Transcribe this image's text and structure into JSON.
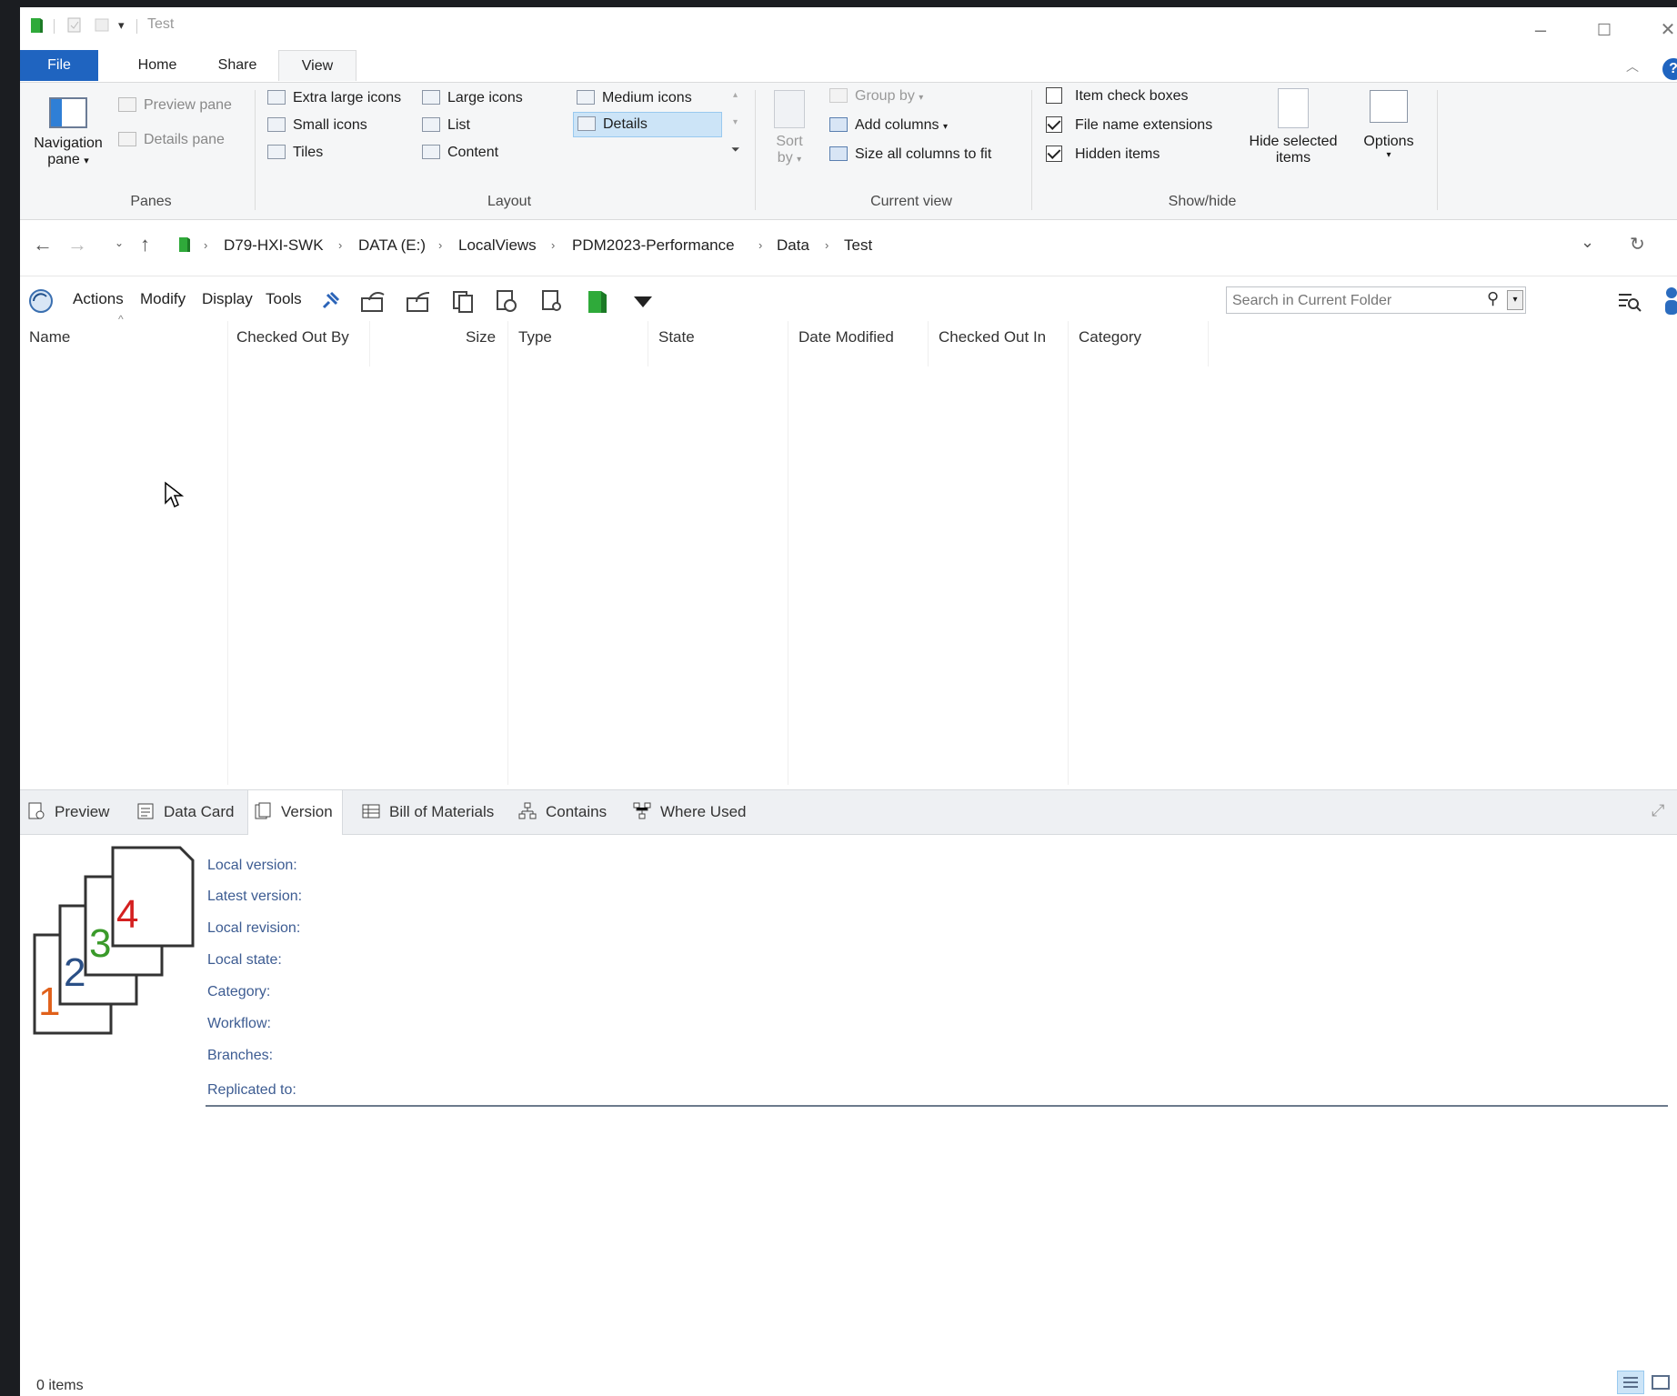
{
  "window": {
    "title": "Test",
    "minimize": "–",
    "maximize": "☐",
    "close": "✕",
    "help": "?"
  },
  "ribbon_tabs": [
    {
      "label": "File"
    },
    {
      "label": "Home"
    },
    {
      "label": "Share"
    },
    {
      "label": "View"
    }
  ],
  "ribbon": {
    "panes": {
      "navigation_pane_line1": "Navigation",
      "navigation_pane_line2": "pane",
      "preview_pane": "Preview pane",
      "details_pane": "Details pane",
      "group_label": "Panes"
    },
    "layout": {
      "extra_large_icons": "Extra large icons",
      "large_icons": "Large icons",
      "medium_icons": "Medium icons",
      "small_icons": "Small icons",
      "list": "List",
      "details": "Details",
      "tiles": "Tiles",
      "content": "Content",
      "group_label": "Layout"
    },
    "current_view": {
      "sort_by_line1": "Sort",
      "sort_by_line2": "by",
      "group_by": "Group by",
      "add_columns": "Add columns",
      "size_all_columns": "Size all columns to fit",
      "group_label": "Current view"
    },
    "show_hide": {
      "item_check_boxes": "Item check boxes",
      "item_check_boxes_checked": false,
      "file_name_extensions": "File name extensions",
      "file_name_extensions_checked": true,
      "hidden_items": "Hidden items",
      "hidden_items_checked": true,
      "hide_selected_line1": "Hide selected",
      "hide_selected_line2": "items",
      "group_label": "Show/hide"
    },
    "options": "Options"
  },
  "address_bar": {
    "crumbs": [
      "D79-HXI-SWK",
      "DATA (E:)",
      "LocalViews",
      "PDM2023-Performance",
      "Data",
      "Test"
    ]
  },
  "pdm_toolbar": {
    "menus": [
      "Actions",
      "Modify",
      "Display",
      "Tools"
    ],
    "search_placeholder": "Search in Current Folder"
  },
  "columns": [
    "Name",
    "Checked Out By",
    "Size",
    "Type",
    "State",
    "Date Modified",
    "Checked Out In",
    "Category"
  ],
  "bottom_tabs": [
    "Preview",
    "Data Card",
    "Version",
    "Bill of Materials",
    "Contains",
    "Where Used"
  ],
  "version_panel": {
    "labels": [
      "Local version:",
      "Latest version:",
      "Local revision:",
      "Local state:",
      "Category:",
      "Workflow:",
      "Branches:",
      "Replicated to:"
    ],
    "icon_numbers": [
      "1",
      "2",
      "3",
      "4"
    ]
  },
  "status": {
    "item_count": "0 items"
  },
  "colors": {
    "file_tab": "#1f64c0",
    "vault_green": "#2faa3a",
    "label_blue": "#3d5c92"
  }
}
